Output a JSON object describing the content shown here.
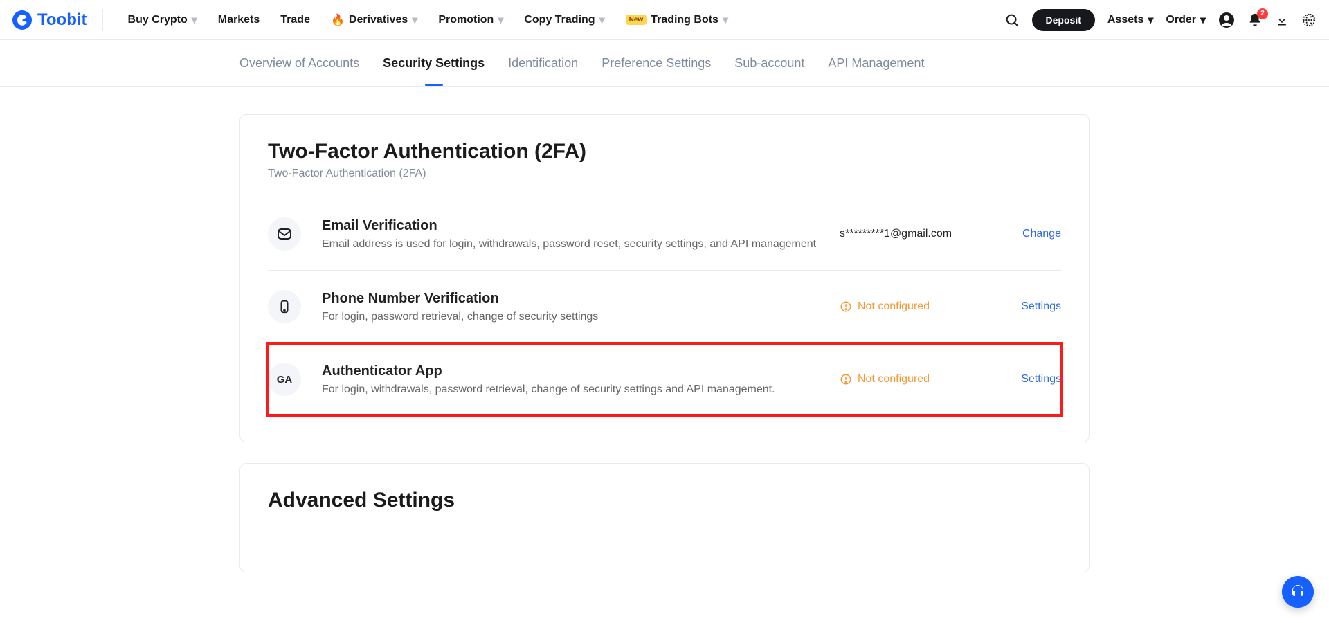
{
  "brand": {
    "name": "Toobit"
  },
  "nav": {
    "buy": "Buy Crypto",
    "markets": "Markets",
    "trade": "Trade",
    "derivatives": "Derivatives",
    "promotion": "Promotion",
    "copy": "Copy Trading",
    "bots_badge": "New",
    "bots": "Trading Bots",
    "deposit": "Deposit",
    "assets": "Assets",
    "order": "Order",
    "notif_count": "2"
  },
  "tabs": {
    "overview": "Overview of Accounts",
    "security": "Security Settings",
    "identification": "Identification",
    "preference": "Preference Settings",
    "subaccount": "Sub-account",
    "api": "API Management"
  },
  "tfa": {
    "heading": "Two-Factor Authentication (2FA)",
    "subheading": "Two-Factor Authentication (2FA)",
    "email": {
      "title": "Email Verification",
      "desc": "Email address is used for login, withdrawals, password reset, security settings, and API management",
      "value": "s*********1@gmail.com",
      "action": "Change"
    },
    "phone": {
      "title": "Phone Number Verification",
      "desc": "For login, password retrieval, change of security settings",
      "status": "Not configured",
      "action": "Settings"
    },
    "ga": {
      "icon_text": "GA",
      "title": "Authenticator App",
      "desc": "For login, withdrawals, password retrieval, change of security settings and API management.",
      "status": "Not configured",
      "action": "Settings"
    }
  },
  "advanced": {
    "heading": "Advanced Settings"
  }
}
